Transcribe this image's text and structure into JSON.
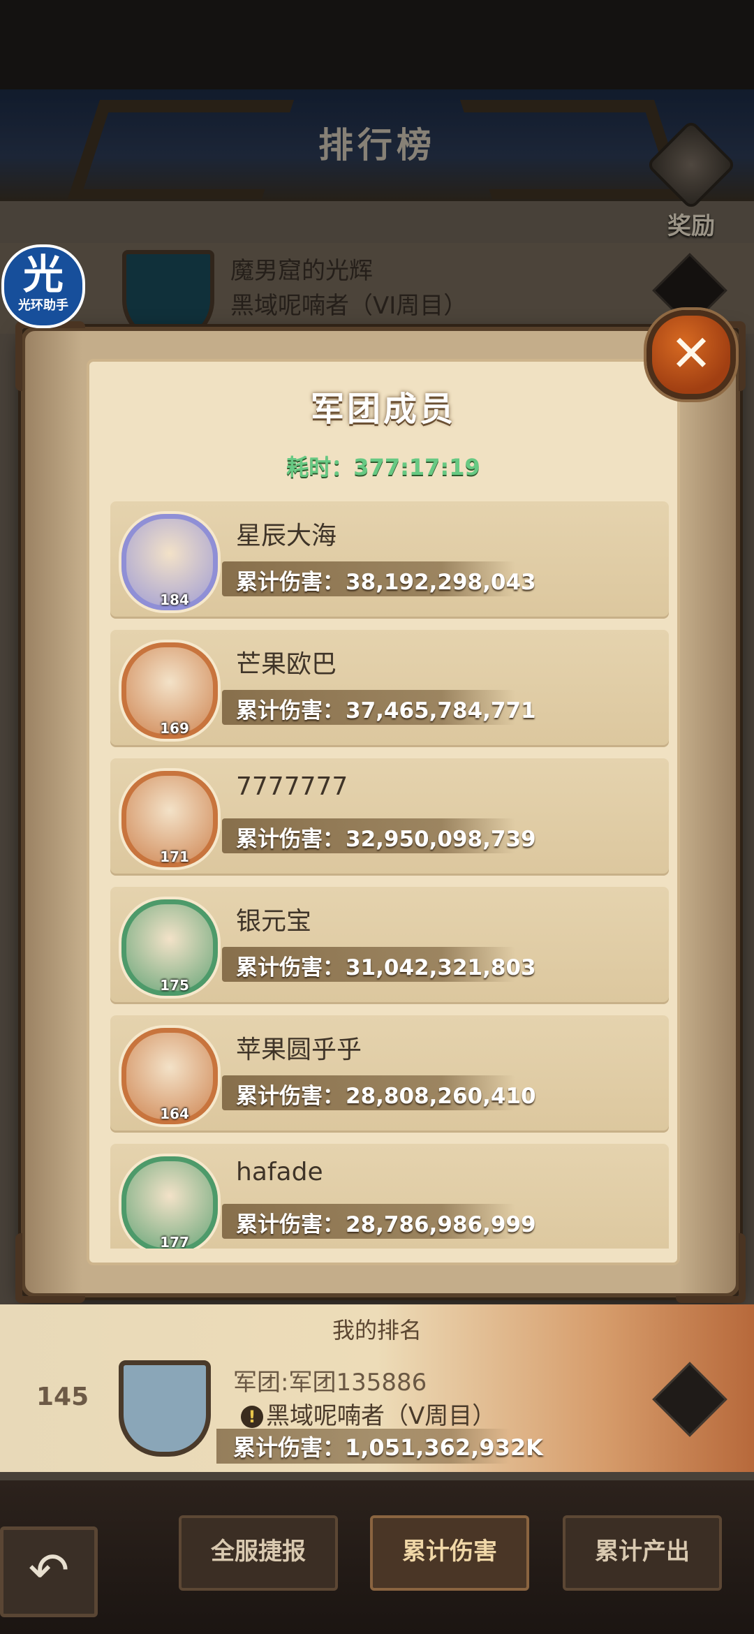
{
  "ranking_screen": {
    "title": "排行榜",
    "reward_label": "奖励",
    "top_entry": {
      "guild_name": "魔男窟的光辉",
      "boss": "黑域呢喃者（VI周目）"
    }
  },
  "overlay_badge": {
    "glyph": "光",
    "label": "光环助手"
  },
  "modal": {
    "title": "军团成员",
    "time_label": "耗时：",
    "time_value": "377:17:19",
    "close_label": "✕",
    "damage_label": "累计伤害：",
    "members": [
      {
        "name": "星辰大海",
        "level": "184",
        "damage": "38,192,298,043",
        "ring": "#8f8fd6"
      },
      {
        "name": "芒果欧巴",
        "level": "169",
        "damage": "37,465,784,771",
        "ring": "#c8743d"
      },
      {
        "name": "7777777",
        "level": "171",
        "damage": "32,950,098,739",
        "ring": "#c8743d"
      },
      {
        "name": "银元宝",
        "level": "175",
        "damage": "31,042,321,803",
        "ring": "#4d9a6a"
      },
      {
        "name": "苹果圆乎乎",
        "level": "164",
        "damage": "28,808,260,410",
        "ring": "#c8743d"
      },
      {
        "name": "hafade",
        "level": "177",
        "damage": "28,786,986,999",
        "ring": "#4d9a6a"
      }
    ]
  },
  "my_ranking": {
    "title": "我的排名",
    "rank": "145",
    "guild": "军团:军团135886",
    "boss": "黑域呢喃者（V周目）",
    "damage": "累计伤害：1,051,362,932K"
  },
  "tabs": [
    {
      "label": "全服捷报"
    },
    {
      "label": "累计伤害"
    },
    {
      "label": "累计产出"
    }
  ],
  "back_label": "↶"
}
